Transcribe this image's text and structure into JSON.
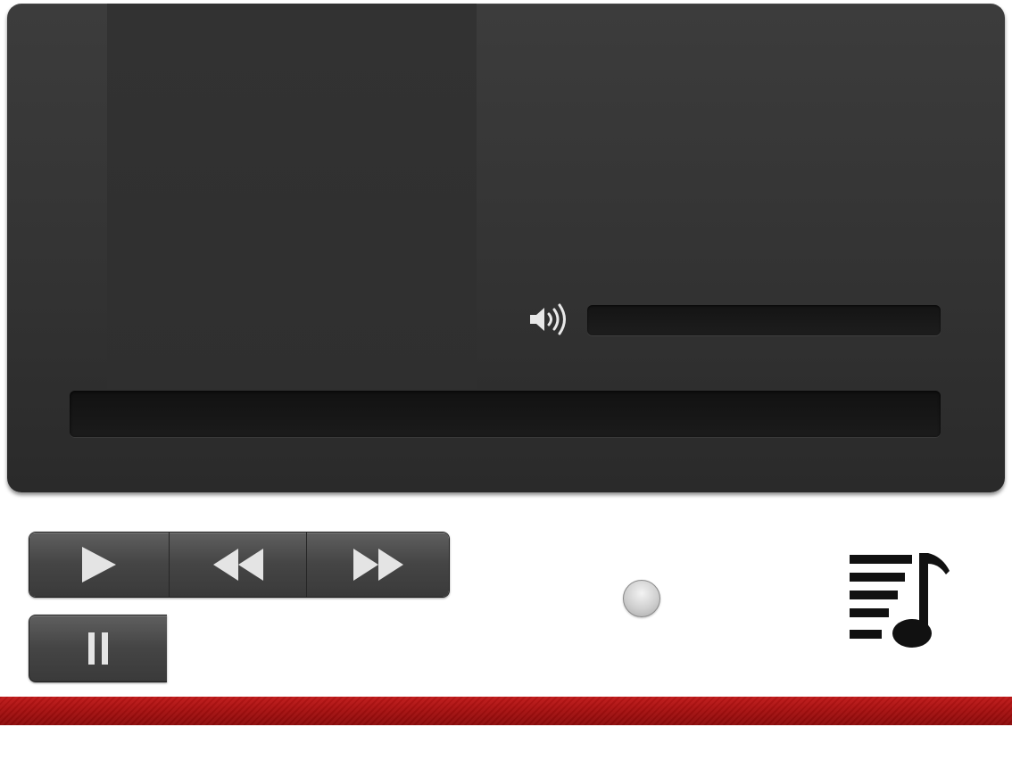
{
  "player": {
    "volume_icon": "speaker-volume-icon",
    "volume_level": 0,
    "progress": 0
  },
  "transport": {
    "buttons": [
      {
        "name": "play",
        "icon": "play-icon"
      },
      {
        "name": "rewind",
        "icon": "rewind-icon"
      },
      {
        "name": "fast-forward",
        "icon": "fast-forward-icon"
      },
      {
        "name": "pause",
        "icon": "pause-icon"
      }
    ]
  },
  "playlist": {
    "icon": "playlist-music-icon"
  },
  "colors": {
    "panel": "#333333",
    "button": "#4a4a4a",
    "accent_bar": "#a81212",
    "icon_light": "#e6e6e6"
  }
}
